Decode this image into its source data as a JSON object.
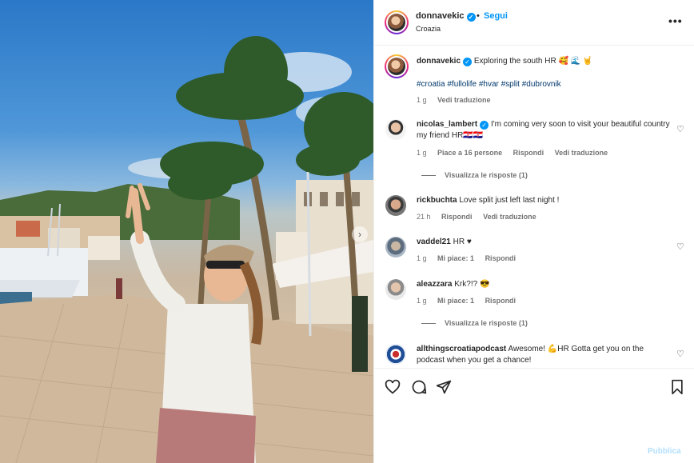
{
  "post": {
    "username": "donnavekic",
    "follow_label": "Segui",
    "dot": "•",
    "location": "Croazia",
    "more_label": "•••",
    "caption_text": "Exploring the south",
    "caption_emoji": "HR 🥰 🌊 🤘",
    "hashtags": "#croatia #fullolife #hvar #split #dubrovnik",
    "time": "1 g",
    "translate": "Vedi traduzione",
    "carousel_next": "›"
  },
  "comments": [
    {
      "username": "nicolas_lambert",
      "text": "I'm coming very soon to visit your beautiful country my friend HR🇭🇷🇭🇷",
      "time": "1 g",
      "likes": "Piace a 16 persone",
      "reply": "Rispondi",
      "translate": "Vedi traduzione",
      "replies": "Visualizza le risposte (1)"
    },
    {
      "username": "rickbuchta",
      "text": "Love split just left last night !",
      "time": "21 h",
      "reply": "Rispondi",
      "translate": "Vedi traduzione"
    },
    {
      "username": "vaddel21",
      "text": "HR ♥",
      "time": "1 g",
      "likes": "Mi piace: 1",
      "reply": "Rispondi"
    },
    {
      "username": "aleazzara",
      "text": "Krk?!? 😎",
      "time": "1 g",
      "likes": "Mi piace: 1",
      "reply": "Rispondi",
      "replies": "Visualizza le risposte (1)"
    },
    {
      "username": "allthingscroatiapodcast",
      "text": "Awesome! 💪HR Gotta get you on the podcast when you get a chance!"
    }
  ],
  "icons": {
    "heart": "♡",
    "verified": "✓"
  },
  "publish_label": "Pubblica",
  "colors": {
    "accent": "#0095f6",
    "publish_disabled": "#b2dffc",
    "hashtag": "#00376b",
    "meta": "#737373"
  }
}
